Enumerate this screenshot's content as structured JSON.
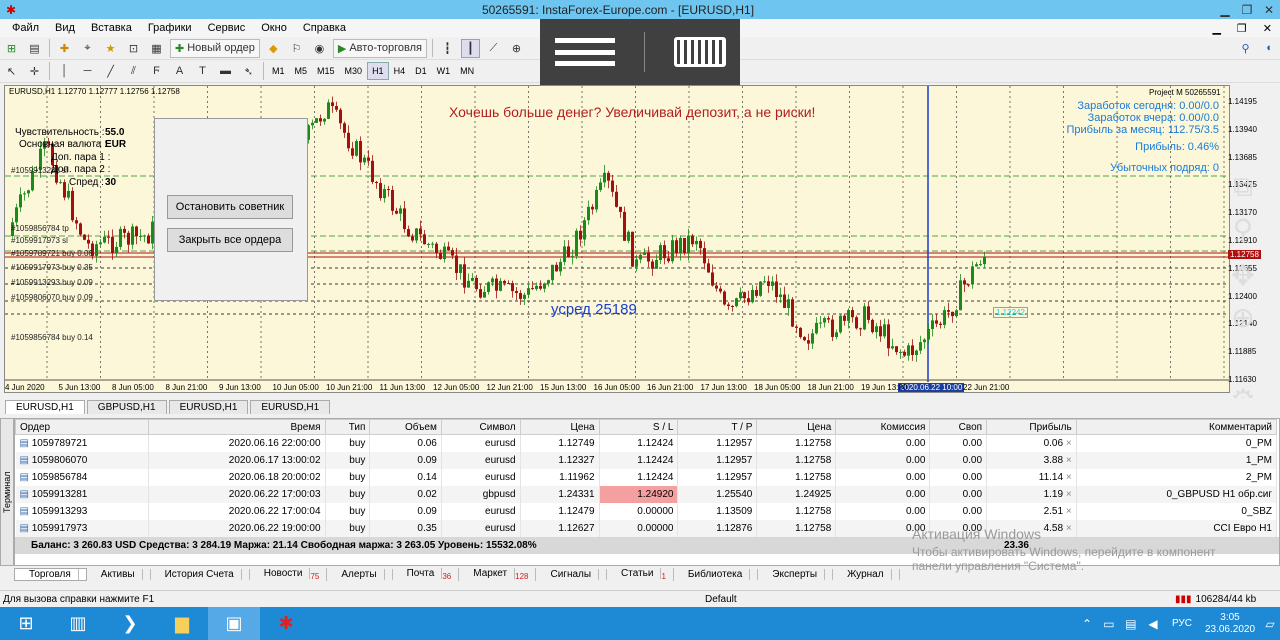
{
  "window": {
    "title": "50265591: InstaForex-Europe.com - [EURUSD,H1]"
  },
  "menu": [
    "Файл",
    "Вид",
    "Вставка",
    "Графики",
    "Сервис",
    "Окно",
    "Справка"
  ],
  "toolbar": {
    "new_order": "Новый ордер",
    "autotrading": "Авто-торговля"
  },
  "timeframes": [
    "M1",
    "M5",
    "M15",
    "M30",
    "H1",
    "H4",
    "D1",
    "W1",
    "MN"
  ],
  "chart": {
    "header": "EURUSD,H1  1.12770 1.12777 1.12756 1.12758",
    "banner": "Хочешь больше денег? Увеличивай депозит, а не риски!",
    "project": "Project M   50265591",
    "hud": [
      "Заработок сегодня: 0.00/0.0",
      "Заработок вчера: 0.00/0.0",
      "Прибыль за месяц: 112.75/3.5",
      "Прибыль: 0.46%",
      "Убыточных подряд: 0"
    ],
    "avg_label": "усред 25189",
    "price_tag": "1.12758",
    "price_tag2": "1.12242",
    "prices": [
      "1.14195",
      "1.13940",
      "1.13685",
      "1.13425",
      "1.13170",
      "1.12910",
      "1.12655",
      "1.12400",
      "1.12140",
      "1.11885",
      "1.11630"
    ],
    "times": [
      "4 Jun 2020",
      "5 Jun 13:00",
      "8 Jun 05:00",
      "8 Jun 21:00",
      "9 Jun 13:00",
      "10 Jun 05:00",
      "10 Jun 21:00",
      "11 Jun 13:00",
      "12 Jun 05:00",
      "12 Jun 21:00",
      "15 Jun 13:00",
      "16 Jun 05:00",
      "16 Jun 21:00",
      "17 Jun 13:00",
      "18 Jun 05:00",
      "18 Jun 21:00",
      "19 Jun 13:00",
      "2020.06.22 10:00",
      "22 Jun 21:00"
    ],
    "order_labels": [
      "#1059917973 sl",
      "#1059856784 tp",
      "#1059789721 buy 0.06",
      "#1059917973 buy 0.35",
      "#1059913293 buy 0.09",
      "#1059806070 buy 0.09",
      "#1059856784 buy 0.14",
      "#1059913281 sl"
    ]
  },
  "ea": {
    "labels": [
      [
        "Чувствительность :",
        "55.0"
      ],
      [
        "Основная валюта :",
        "EUR"
      ],
      [
        "Доп. пара 1 :",
        ""
      ],
      [
        "Доп. пара 2 :",
        ""
      ],
      [
        "Спред :",
        "30"
      ]
    ],
    "stop": "Остановить советник",
    "close_all": "Закрыть все ордера"
  },
  "chart_tabs": [
    "EURUSD,H1",
    "GBPUSD,H1",
    "EURUSD,H1",
    "EURUSD,H1"
  ],
  "terminal": {
    "side": "Терминал",
    "columns": [
      "Ордер",
      "Время",
      "Тип",
      "Объем",
      "Символ",
      "Цена",
      "S / L",
      "T / P",
      "Цена",
      "Комиссия",
      "Своп",
      "Прибыль",
      "Комментарий"
    ],
    "rows": [
      [
        "1059789721",
        "2020.06.16 22:00:00",
        "buy",
        "0.06",
        "eurusd",
        "1.12749",
        "1.12424",
        "1.12957",
        "1.12758",
        "0.00",
        "0.00",
        "0.06",
        "0_PM"
      ],
      [
        "1059806070",
        "2020.06.17 13:00:02",
        "buy",
        "0.09",
        "eurusd",
        "1.12327",
        "1.12424",
        "1.12957",
        "1.12758",
        "0.00",
        "0.00",
        "3.88",
        "1_PM"
      ],
      [
        "1059856784",
        "2020.06.18 20:00:02",
        "buy",
        "0.14",
        "eurusd",
        "1.11962",
        "1.12424",
        "1.12957",
        "1.12758",
        "0.00",
        "0.00",
        "11.14",
        "2_PM"
      ],
      [
        "1059913281",
        "2020.06.22 17:00:03",
        "buy",
        "0.02",
        "gbpusd",
        "1.24331",
        "1.24920",
        "1.25540",
        "1.24925",
        "0.00",
        "0.00",
        "1.19",
        "0_GBPUSD H1 обр.сиг"
      ],
      [
        "1059913293",
        "2020.06.22 17:00:04",
        "buy",
        "0.09",
        "eurusd",
        "1.12479",
        "0.00000",
        "1.13509",
        "1.12758",
        "0.00",
        "0.00",
        "2.51",
        "0_SBZ"
      ],
      [
        "1059917973",
        "2020.06.22 19:00:00",
        "buy",
        "0.35",
        "eurusd",
        "1.12627",
        "0.00000",
        "1.12876",
        "1.12758",
        "0.00",
        "0.00",
        "4.58",
        "CCI Евро H1"
      ]
    ],
    "balance": "Баланс: 3 260.83 USD  Средства: 3 284.19  Маржа: 21.14  Свободная маржа: 3 263.05  Уровень: 15532.08%",
    "total": "23.36",
    "tabs": [
      [
        "Торговля",
        ""
      ],
      [
        "Активы",
        ""
      ],
      [
        "История Счета",
        ""
      ],
      [
        "Новости",
        "75"
      ],
      [
        "Алерты",
        ""
      ],
      [
        "Почта",
        "36"
      ],
      [
        "Маркет",
        "128"
      ],
      [
        "Сигналы",
        ""
      ],
      [
        "Статьи",
        "1"
      ],
      [
        "Библиотека",
        ""
      ],
      [
        "Эксперты",
        ""
      ],
      [
        "Журнал",
        ""
      ]
    ]
  },
  "status": {
    "help": "Для вызова справки нажмите F1",
    "profile": "Default",
    "traffic": "106284/44 kb"
  },
  "watermark": {
    "title": "Активация Windows",
    "text1": "Чтобы активировать Windows, перейдите в компонент",
    "text2": "панели управления \"Система\"."
  },
  "taskbar": {
    "lang": "РУС",
    "time": "3:05",
    "date": "23.06.2020"
  },
  "colors": {
    "chart_bg": "#fbf7d8",
    "bull": "#1a8a1a",
    "bear": "#a01010",
    "accent": "#1a7bd8",
    "taskbar": "#1e8ad6"
  }
}
